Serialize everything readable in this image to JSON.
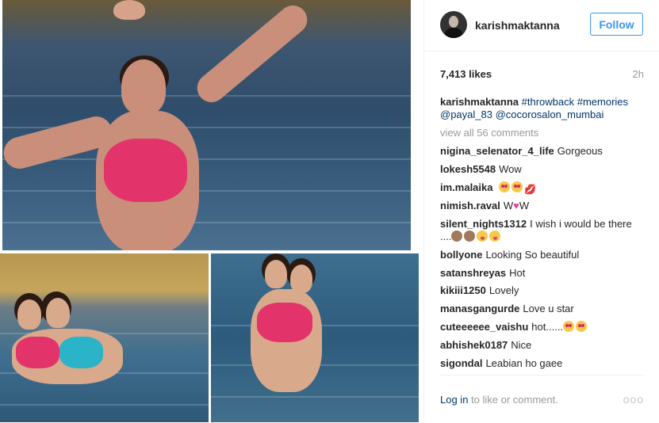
{
  "header": {
    "username": "karishmaktanna",
    "follow_label": "Follow"
  },
  "post": {
    "likes": "7,413 likes",
    "time_ago": "2h",
    "caption": {
      "username": "karishmaktanna",
      "tags": [
        "#throwback",
        "#memories",
        "@payal_83",
        "@cocorosalon_mumbai"
      ]
    },
    "view_all": "view all 56 comments"
  },
  "comments": [
    {
      "username": "nigina_selenator_4_life",
      "text": "Gorgeous"
    },
    {
      "username": "lokesh5548",
      "text": "Wow"
    },
    {
      "username": "im.malaika",
      "text": "",
      "emoji": [
        "heart-eyes",
        "heart-eyes",
        "kiss"
      ]
    },
    {
      "username": "nimish.raval",
      "text_before": "W",
      "text_after": "W",
      "emoji": [
        "heart"
      ]
    },
    {
      "username": "silent_nights1312",
      "text": "I wish i would be there",
      "line2": "....",
      "emoji": [
        "monkey",
        "monkey",
        "tongue",
        "tongue"
      ]
    },
    {
      "username": "bollyone",
      "text": "Looking So beautiful"
    },
    {
      "username": "satanshreyas",
      "text": "Hot"
    },
    {
      "username": "kikiii1250",
      "text": "Lovely"
    },
    {
      "username": "manasgangurde",
      "text": "Love u star"
    },
    {
      "username": "cuteeeeee_vaishu",
      "text": "hot......",
      "emoji": [
        "heart-eyes",
        "heart-eyes"
      ]
    },
    {
      "username": "abhishek0187",
      "text": "Nice"
    },
    {
      "username": "sigondal",
      "text": "Leabian ho gaee"
    }
  ],
  "footer": {
    "login_link": "Log in",
    "login_text": "to like or comment.",
    "more_label": "ooo"
  },
  "icons": {
    "more": "more-options-icon",
    "heart": "heart-emoji-icon"
  },
  "colors": {
    "follow_blue": "#3897f0",
    "link_blue": "#003569",
    "muted_gray": "#999999"
  }
}
